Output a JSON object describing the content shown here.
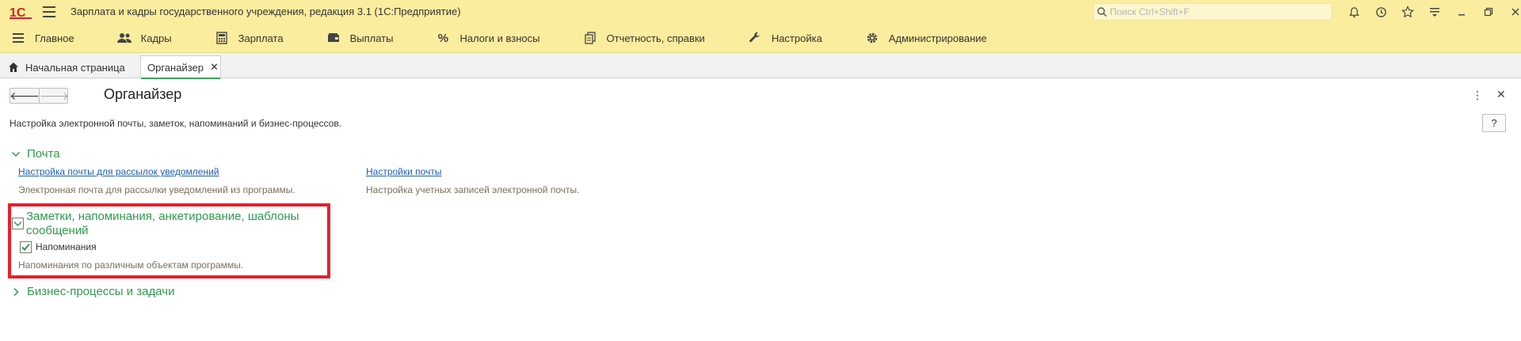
{
  "window": {
    "title": "Зарплата и кадры государственного учреждения, редакция 3.1  (1С:Предприятие)",
    "search_placeholder": "Поиск Ctrl+Shift+F"
  },
  "sections": [
    {
      "label": "Главное",
      "icon": "menu-icon"
    },
    {
      "label": "Кадры",
      "icon": "people-icon"
    },
    {
      "label": "Зарплата",
      "icon": "calculator-icon"
    },
    {
      "label": "Выплаты",
      "icon": "wallet-icon"
    },
    {
      "label": "Налоги и взносы",
      "icon": "percent-icon"
    },
    {
      "label": "Отчетность, справки",
      "icon": "reports-icon"
    },
    {
      "label": "Настройка",
      "icon": "wrench-icon"
    },
    {
      "label": "Администрирование",
      "icon": "gear-icon"
    }
  ],
  "tabs": {
    "home": "Начальная страница",
    "active": "Органайзер"
  },
  "form": {
    "title": "Органайзер",
    "description": "Настройка электронной почты, заметок, напоминаний и бизнес-процессов.",
    "help": "?",
    "groups": {
      "mail": {
        "title": "Почта",
        "link1": "Настройка почты для рассылок уведомлений",
        "hint1": "Электронная почта для рассылки уведомлений из программы.",
        "link2": "Настройки почты",
        "hint2": "Настройка учетных записей электронной почты."
      },
      "notes": {
        "title": "Заметки, напоминания, анкетирование, шаблоны сообщений",
        "checkbox_label": "Напоминания",
        "checkbox_checked": true,
        "hint": "Напоминания по различным объектам программы."
      },
      "bp": {
        "title": "Бизнес-процессы и задачи"
      }
    }
  },
  "colors": {
    "panel": "#fbed9e",
    "group_title": "#2e9a4f",
    "link": "#1f5fb4",
    "highlight": "#e8202a"
  }
}
